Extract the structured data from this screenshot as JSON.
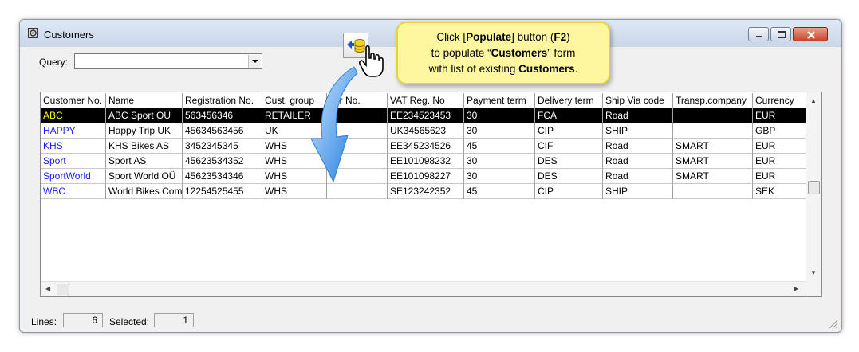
{
  "window": {
    "title": "Customers"
  },
  "query": {
    "label": "Query:",
    "value": ""
  },
  "table": {
    "columns": [
      {
        "label": "Customer No.",
        "w": 82
      },
      {
        "label": "Name",
        "w": 96
      },
      {
        "label": "Registration No.",
        "w": 100
      },
      {
        "label": "Cust. group",
        "w": 81
      },
      {
        "label": "Jur No.",
        "w": 76
      },
      {
        "label": "VAT Reg. No",
        "w": 96
      },
      {
        "label": "Payment term",
        "w": 89
      },
      {
        "label": "Delivery term",
        "w": 85
      },
      {
        "label": "Ship Via code",
        "w": 88
      },
      {
        "label": "Transp.company",
        "w": 100
      },
      {
        "label": "Currency",
        "w": 70
      }
    ],
    "rows": [
      [
        "ABC",
        "ABC Sport OÜ",
        "563456346",
        "RETAILER",
        "",
        "EE234523453",
        "30",
        "FCA",
        "Road",
        "",
        "EUR"
      ],
      [
        "HAPPY",
        "Happy Trip UK",
        "45634563456",
        "UK",
        "",
        "UK34565623",
        "30",
        "CIP",
        "SHIP",
        "",
        "GBP"
      ],
      [
        "KHS",
        "KHS Bikes AS",
        "3452345345",
        "WHS",
        "",
        "EE345234526",
        "45",
        "CIF",
        "Road",
        "SMART",
        "EUR"
      ],
      [
        "Sport",
        "Sport AS",
        "45623534352",
        "WHS",
        "",
        "EE101098232",
        "30",
        "DES",
        "Road",
        "SMART",
        "EUR"
      ],
      [
        "SportWorld",
        "Sport World OÜ",
        "45623534346",
        "WHS",
        "",
        "EE101098227",
        "30",
        "DES",
        "Road",
        "SMART",
        "EUR"
      ],
      [
        "WBC",
        "World Bikes Comp",
        "12254525455",
        "WHS",
        "",
        "SE123242352",
        "45",
        "CIP",
        "SHIP",
        "",
        "SEK"
      ]
    ],
    "selected_row": 0
  },
  "status": {
    "lines_label": "Lines:",
    "lines_value": "6",
    "selected_label": "Selected:",
    "selected_value": "1"
  },
  "callout": {
    "line1_pre": "Click [",
    "line1_bold1": "Populate",
    "line1_mid": "] button (",
    "line1_bold2": "F2",
    "line1_post": ")",
    "line2_pre": "to populate “",
    "line2_bold": "Customers",
    "line2_post": "” form",
    "line3_pre": "with list of existing ",
    "line3_bold": "Customers",
    "line3_post": "."
  },
  "colors": {
    "key_link": "#1a1aff",
    "selected_bg": "#000000",
    "selected_key": "#ffff00",
    "callout_bg": "#fff7a0"
  }
}
